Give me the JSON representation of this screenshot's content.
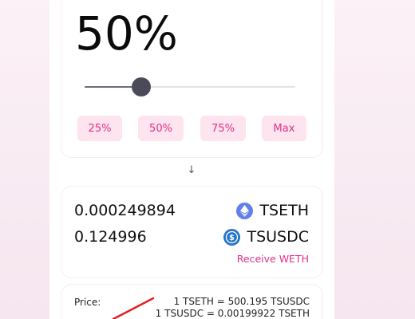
{
  "amount": {
    "percent_display": "50%",
    "slider_level_percent": 27
  },
  "quick_buttons": [
    {
      "label": "25%"
    },
    {
      "label": "50%"
    },
    {
      "label": "75%"
    },
    {
      "label": "Max"
    }
  ],
  "direction_arrow": "↓",
  "receive": {
    "rows": [
      {
        "amount": "0.000249894",
        "token": "TSETH",
        "icon": "eth-icon"
      },
      {
        "amount": "0.124996",
        "token": "TSUSDC",
        "icon": "usdc-icon"
      }
    ],
    "receive_link": "Receive WETH"
  },
  "price": {
    "label": "Price:",
    "line1": "1 TSETH = 500.195 TSUSDC",
    "line2": "1 TSUSDC = 0.00199922 TSETH"
  },
  "colors": {
    "accent": "#e0308a",
    "eth_blue": "#627eea",
    "usdc_blue": "#2775ca",
    "annotation_arrow": "#e02020"
  }
}
